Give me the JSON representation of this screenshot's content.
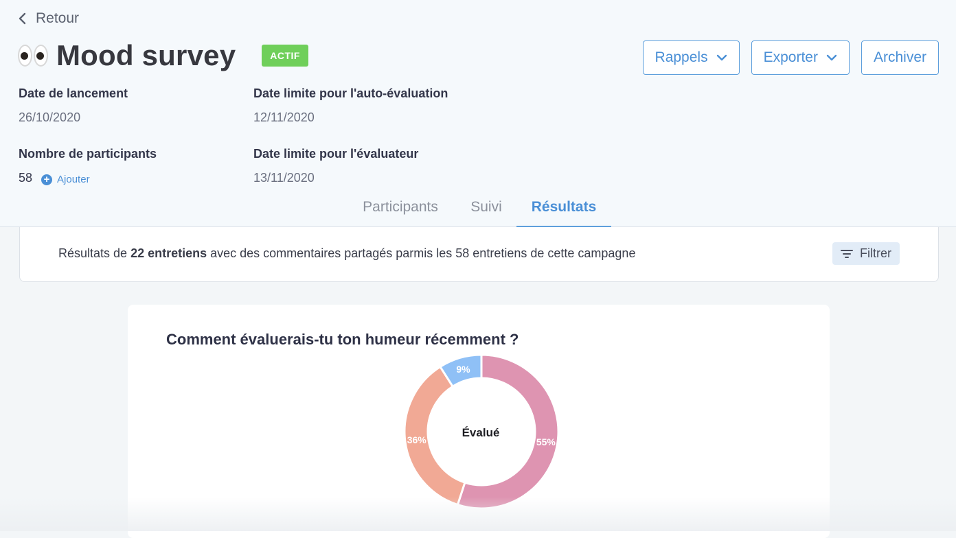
{
  "nav": {
    "back_label": "Retour"
  },
  "survey": {
    "title": "Mood survey",
    "status": "ACTIF",
    "status_color": "#6fcf5a"
  },
  "actions": {
    "reminders": "Rappels",
    "export": "Exporter",
    "archive": "Archiver"
  },
  "meta": {
    "launch_label": "Date de lancement",
    "launch_value": "26/10/2020",
    "self_deadline_label": "Date limite pour l'auto-évaluation",
    "self_deadline_value": "12/11/2020",
    "participants_label": "Nombre de participants",
    "participants_value": "58",
    "add_label": "Ajouter",
    "reviewer_deadline_label": "Date limite pour l'évaluateur",
    "reviewer_deadline_value": "13/11/2020"
  },
  "tabs": [
    {
      "label": "Participants",
      "active": false
    },
    {
      "label": "Suivi",
      "active": false
    },
    {
      "label": "Résultats",
      "active": true
    }
  ],
  "results": {
    "prefix": "Résultats de ",
    "bold": "22 entretiens",
    "suffix": " avec des commentaires partagés parmis les 58 entretiens de cette campagne",
    "filter_label": "Filtrer"
  },
  "question": {
    "text": "Comment évaluerais-tu ton humeur récemment ?"
  },
  "chart_data": {
    "type": "pie",
    "center_label": "Évalué",
    "slices": [
      {
        "value": 55,
        "label": "55%",
        "color": "#de94b1"
      },
      {
        "value": 36,
        "label": "36%",
        "color": "#f1a995"
      },
      {
        "value": 9,
        "label": "9%",
        "color": "#8fc0f6"
      }
    ]
  },
  "colors": {
    "accent": "#4a8fd6",
    "header_bg": "#f5f9fc"
  }
}
